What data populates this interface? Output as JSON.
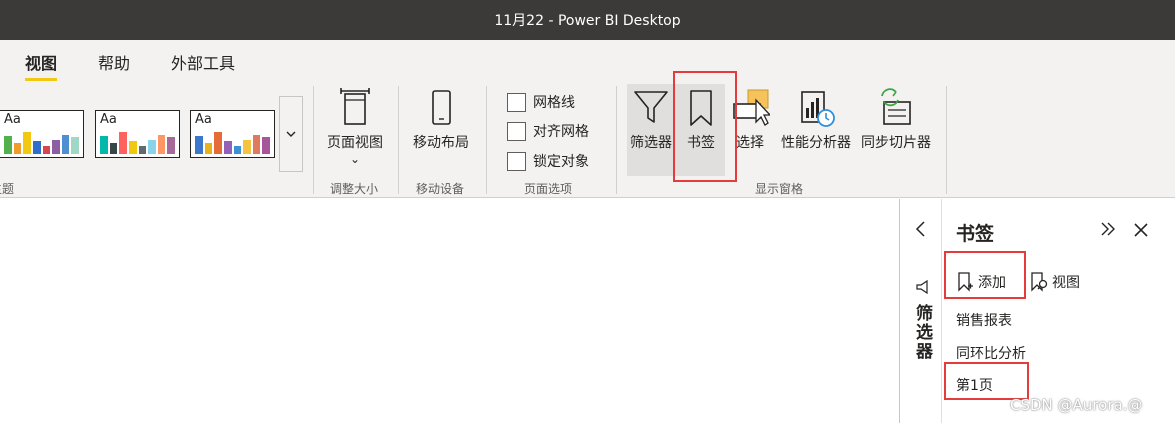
{
  "window": {
    "title": "11月22 - Power BI Desktop"
  },
  "ribbon": {
    "tabs": [
      {
        "label": "视图",
        "active": true
      },
      {
        "label": "帮助",
        "active": false
      },
      {
        "label": "外部工具",
        "active": false
      }
    ],
    "themes": {
      "group_label": "主题",
      "tile_text": "Aa",
      "tiles": [
        [
          "#52b04f",
          "#ef9c2b",
          "#f2c811",
          "#2f6ec9",
          "#d64550",
          "#8e5ea2",
          "#4f8fd1",
          "#a0d8c5"
        ],
        [
          "#01b8aa",
          "#374649",
          "#fd625e",
          "#f2c80f",
          "#5f6b6d",
          "#8ad4eb",
          "#fe9666",
          "#a66999"
        ],
        [
          "#3b78cc",
          "#e8b31a",
          "#e66c37",
          "#9361b8",
          "#3e8fd4",
          "#f5c242",
          "#e07a5f",
          "#a8569a"
        ]
      ]
    },
    "groups": {
      "page_view": {
        "button": "页面视图",
        "dropdown": "⌄",
        "group_label": "调整大小"
      },
      "mobile": {
        "button": "移动布局",
        "group_label": "移动设备"
      },
      "page_options": {
        "group_label": "页面选项",
        "checkboxes": [
          "网格线",
          "对齐网格",
          "锁定对象"
        ]
      },
      "show_panes": {
        "group_label": "显示窗格",
        "buttons": [
          "筛选器",
          "书签",
          "选择",
          "性能分析器",
          "同步切片器"
        ]
      }
    }
  },
  "filter_pane": {
    "label": "筛选器"
  },
  "bookmark_pane": {
    "title": "书签",
    "add_label": "添加",
    "view_label": "视图",
    "items": [
      "销售报表",
      "同环比分析",
      "第1页"
    ]
  },
  "watermark": "CSDN @Aurora.@",
  "colors": {
    "highlight_border": "#e43c3c",
    "tab_underline": "#f2c811",
    "title_bar": "#3b3a39"
  }
}
